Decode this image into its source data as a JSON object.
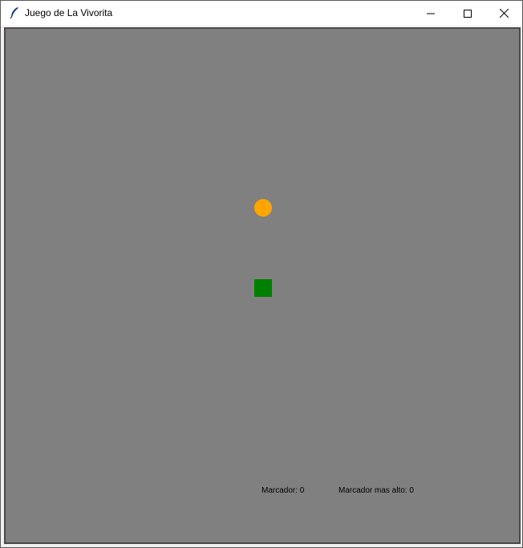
{
  "window": {
    "title": "Juego de La Vivorita",
    "icons": {
      "app": "feather-icon",
      "minimize": "minimize-icon",
      "maximize": "maximize-icon",
      "close": "close-icon"
    }
  },
  "game": {
    "background_color": "#808080",
    "food_color": "#ffa500",
    "snake_color": "#008000",
    "score_text": "Marcador: 0",
    "high_score_text": "Marcador mas alto: 0"
  }
}
